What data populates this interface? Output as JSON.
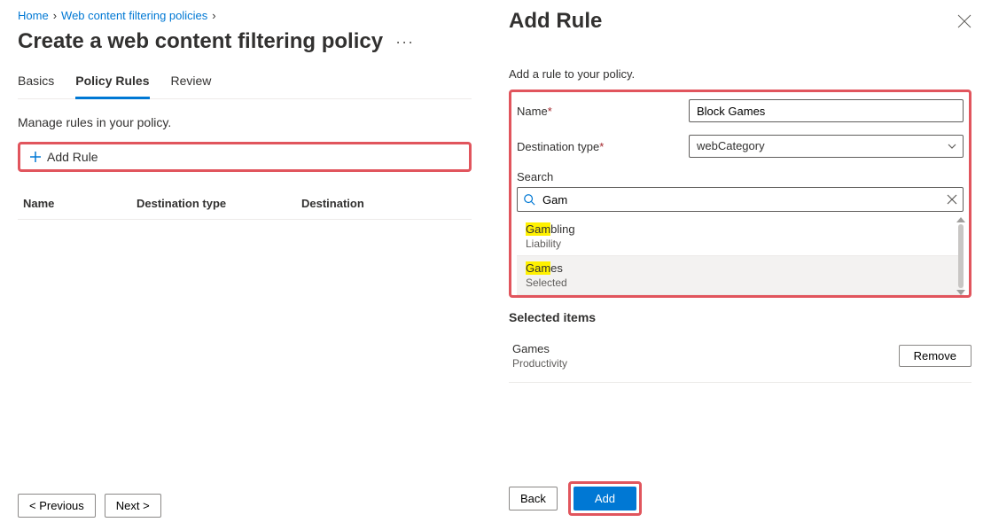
{
  "breadcrumb": {
    "items": [
      "Home",
      "Web content filtering policies"
    ]
  },
  "page_title": "Create a web content filtering policy",
  "tabs": {
    "basics": "Basics",
    "policy_rules": "Policy Rules",
    "review": "Review"
  },
  "left_desc": "Manage rules in your policy.",
  "add_rule_label": "Add Rule",
  "table": {
    "col_name": "Name",
    "col_dtype": "Destination type",
    "col_dest": "Destination"
  },
  "footer_left": {
    "prev": "< Previous",
    "next": "Next >"
  },
  "panel": {
    "title": "Add Rule",
    "subtitle": "Add a rule to your policy.",
    "name_label": "Name",
    "name_value": "Block Games",
    "dest_label": "Destination type",
    "dest_value": "webCategory",
    "search_label": "Search",
    "search_value": "Gam",
    "results": [
      {
        "title_pre": "Gam",
        "title_rest": "bling",
        "sub": "Liability",
        "selected": false
      },
      {
        "title_pre": "Gam",
        "title_rest": "es",
        "sub": "Selected",
        "selected": true
      }
    ],
    "selected_items_header": "Selected items",
    "selected_items": [
      {
        "title": "Games",
        "sub": "Productivity"
      }
    ],
    "remove_label": "Remove",
    "back_label": "Back",
    "add_label": "Add"
  }
}
